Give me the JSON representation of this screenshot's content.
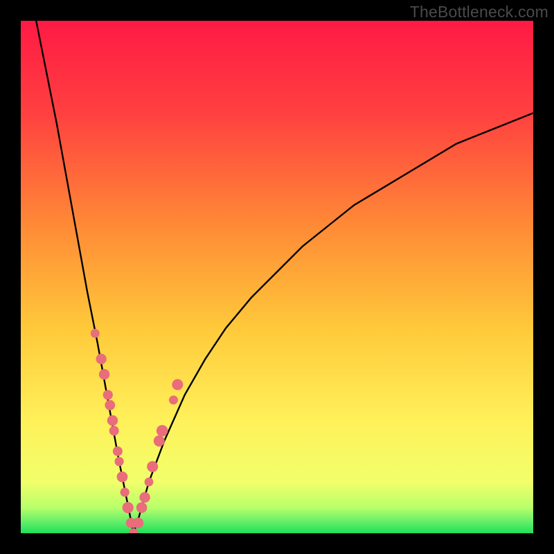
{
  "watermark": "TheBottleneck.com",
  "colors": {
    "bg_black": "#000000",
    "grad_top": "#ff1a44",
    "grad_upper": "#ff5a3a",
    "grad_mid": "#ffb63a",
    "grad_lower": "#fff15a",
    "grad_green": "#1fe05a",
    "curve": "#000000",
    "dot_fill": "#e96d7a",
    "dot_stroke": "#d25260"
  },
  "chart_data": {
    "type": "line",
    "title": "",
    "xlabel": "",
    "ylabel": "",
    "xlim": [
      0,
      100
    ],
    "ylim": [
      0,
      100
    ],
    "notes": "V-shaped bottleneck curve over a red-to-green vertical gradient. Minimum of the curve touches the bottom (green) band at x≈22. Left branch starts at top-left (x≈3, y≈100) and falls steeply; right branch rises and reaches ~y≈82 at x=100.",
    "series": [
      {
        "name": "curve",
        "x": [
          3,
          5,
          7,
          9,
          11,
          13,
          15,
          17,
          19,
          21,
          22,
          23,
          25,
          28,
          32,
          36,
          40,
          45,
          50,
          55,
          60,
          65,
          70,
          75,
          80,
          85,
          90,
          95,
          100
        ],
        "y": [
          100,
          90,
          80,
          69,
          58,
          47,
          37,
          26,
          15,
          5,
          0,
          3,
          10,
          18,
          27,
          34,
          40,
          46,
          51,
          56,
          60,
          64,
          67,
          70,
          73,
          76,
          78,
          80,
          82
        ]
      }
    ],
    "dots": {
      "name": "sample-points",
      "x": [
        14.5,
        15.7,
        16.3,
        17.0,
        17.4,
        17.9,
        18.2,
        18.9,
        19.2,
        19.8,
        20.3,
        20.9,
        21.5,
        22.0,
        22.9,
        23.6,
        24.2,
        25.0,
        25.7,
        27.0,
        27.6,
        29.8,
        30.6
      ],
      "y": [
        39,
        34,
        31,
        27,
        25,
        22,
        20,
        16,
        14,
        11,
        8,
        5,
        2,
        0,
        2,
        5,
        7,
        10,
        13,
        18,
        20,
        26,
        29
      ]
    },
    "gradient_bands": [
      {
        "y_start": 0.0,
        "y_end": 0.03,
        "color": "green"
      },
      {
        "y_start": 0.03,
        "y_end": 0.1,
        "color": "yellow-green"
      },
      {
        "y_start": 0.1,
        "y_end": 0.55,
        "color": "yellow-orange"
      },
      {
        "y_start": 0.55,
        "y_end": 1.0,
        "color": "orange-red"
      }
    ]
  }
}
